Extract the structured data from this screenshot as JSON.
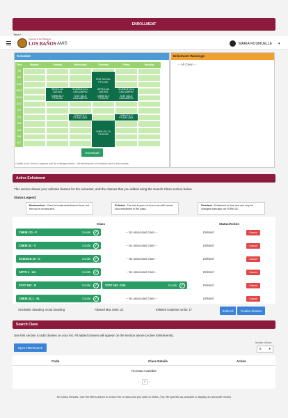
{
  "banner": "ENROLLMENT",
  "term_label": "Term *",
  "header": {
    "university_small": "University of the Philippines",
    "university_big": "LOS BAÑOS",
    "app": "AMIS",
    "user": "MARIA ROUMUELLE"
  },
  "schedule": {
    "title": "Schedule",
    "days": [
      "Time",
      "Monday",
      "Tuesday",
      "Wednesday",
      "Thursday",
      "Friday",
      "Saturday"
    ],
    "times": [
      "7-8",
      "8-9",
      "9-10",
      "10-11",
      "11-12",
      "12-1",
      "1-2",
      "2-3",
      "3-4",
      "4-5",
      "5-6",
      "6-7"
    ],
    "blocks": [
      {
        "day": 4,
        "start": 0.5,
        "end": 3.5,
        "lines": [
          "STAT 162-D4L",
          "PS C-307"
        ]
      },
      {
        "day": 2,
        "start": 3,
        "end": 4,
        "lines": [
          "ARTS 1-U4",
          "CAS B01"
        ]
      },
      {
        "day": 3,
        "start": 3,
        "end": 4,
        "lines": [
          "SCIENCE 10-C",
          "CAS A2MPH2"
        ]
      },
      {
        "day": 4,
        "start": 3,
        "end": 4,
        "lines": [
          "ARTS 1-U4",
          "CAS B01"
        ]
      },
      {
        "day": 5,
        "start": 3,
        "end": 4,
        "lines": [
          "SCIENCE 10-C",
          "CAS A2MPH2"
        ]
      },
      {
        "day": 2,
        "start": 4,
        "end": 5,
        "lines": [
          "CHEM 43-V",
          "PS B-204"
        ]
      },
      {
        "day": 3,
        "start": 4,
        "end": 5,
        "lines": [
          "STAT 162-D",
          "CAS A2MPH1"
        ]
      },
      {
        "day": 4,
        "start": 4,
        "end": 5,
        "lines": [
          "CHEM 43-V",
          "PS B-204"
        ]
      },
      {
        "day": 5,
        "start": 4,
        "end": 5,
        "lines": [
          "STAT 162-D",
          "CAS A2MPH1"
        ]
      },
      {
        "day": 3,
        "start": 7,
        "end": 8,
        "lines": [
          "CHEM 111-F",
          "PS ANX-AMX"
        ]
      },
      {
        "day": 5,
        "start": 7,
        "end": 8,
        "lines": [
          "CHEM 111-F",
          "PS ANX-AMX"
        ]
      },
      {
        "day": 4,
        "start": 8,
        "end": 12,
        "lines": [
          "CHEM 43.1-5L",
          "PS B-209"
        ]
      }
    ],
    "download": "Download",
    "credit": "Credits to Mr. Reven Legarrea and his colleagues/team - the developer/s of schedule used in this module."
  },
  "warnings": {
    "title": "Enlistment Warnings:",
    "text": "-- All Clear --"
  },
  "active": {
    "title": "Active Enlistment",
    "desc": "This section shows your enlisted classes for the semester, and the classes that you added using the Search Class section below.",
    "legend_title": "Status Legend:",
    "legend": [
      {
        "name": "Bookmarked",
        "text": "- Class is bookmarked/saved here, but the slot is not secured."
      },
      {
        "name": "Enlisted",
        "text": "- The slot is yours and you can still cancel your enlistment in the class."
      },
      {
        "name": "Finalized",
        "text": "- Enlistment is final and can only be changed manually via FORM 26."
      }
    ],
    "col_class": "Class",
    "col_status": "Status/Action",
    "rows": [
      {
        "cls": "CHEM 111 - F",
        "units": "3 units",
        "assoc": "-- No associated class --",
        "assoc_units": "",
        "status": "Enlisted",
        "action": "Cancel"
      },
      {
        "cls": "CHEM 43 - V",
        "units": "3 units",
        "assoc": "-- No associated class --",
        "assoc_units": "",
        "status": "Enlisted",
        "action": "Cancel"
      },
      {
        "cls": "SCIENCE 10 - C",
        "units": "3 units",
        "assoc": "-- No associated class --",
        "assoc_units": "",
        "status": "Enlisted",
        "action": "Cancel"
      },
      {
        "cls": "ARTS 1 - U4",
        "units": "3 units",
        "assoc": "-- No associated class --",
        "assoc_units": "",
        "status": "Enlisted",
        "action": "Cancel"
      },
      {
        "cls": "STAT 162 - D",
        "units": "3 units",
        "assoc": "STAT 162 - D4L",
        "assoc_units": "3 units",
        "status": "Enlisted",
        "action": "Cancel"
      },
      {
        "cls": "CHEM 43.1 - 5L",
        "units": "3 units",
        "assoc": "-- No associated class --",
        "assoc_units": "",
        "status": "Enlisted",
        "action": "Cancel"
      }
    ],
    "standing": "Scholastic Standing: Good Standing",
    "max_units": "Allowed Max Units: 22",
    "enlisted_units": "Enlisted Academic Units: 17",
    "enlist_all": "Enlist All",
    "finalize": "Finalize Classes"
  },
  "search": {
    "title": "Search Class",
    "desc": "Use this section to add classes on your list. All added classes will appear on the section above (Active Enlistments).",
    "open_filter": "Open Filter/Search",
    "items_label": "Number of items",
    "items_value": "5",
    "col_code": "Code",
    "col_details": "Class Details",
    "col_action": "Action",
    "empty": "No Data Available",
    "page": "1",
    "note": "No Class Results. Use the filters above to search for a class that you wish to enlist. (Tip: Be specific as possible to display an accurate result.)"
  },
  "colors": {
    "maroon": "#8b1a3c",
    "green": "#2a9d64",
    "dark_green": "#0f6e4a",
    "red": "#e04848",
    "blue": "#3a83d6",
    "orange": "#f0a030"
  }
}
